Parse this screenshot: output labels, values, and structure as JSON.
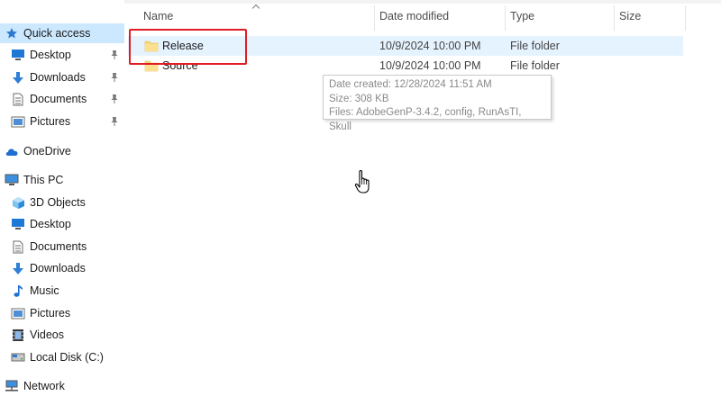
{
  "sidebar": {
    "quick_access": "Quick access",
    "qa_items": [
      {
        "label": "Desktop",
        "icon": "desktop-icon"
      },
      {
        "label": "Downloads",
        "icon": "download-arrow-icon"
      },
      {
        "label": "Documents",
        "icon": "documents-icon"
      },
      {
        "label": "Pictures",
        "icon": "pictures-icon"
      }
    ],
    "onedrive": "OneDrive",
    "this_pc": "This PC",
    "pc_items": [
      {
        "label": "3D Objects",
        "icon": "3d-objects-icon"
      },
      {
        "label": "Desktop",
        "icon": "desktop-icon"
      },
      {
        "label": "Documents",
        "icon": "documents-icon"
      },
      {
        "label": "Downloads",
        "icon": "download-arrow-icon"
      },
      {
        "label": "Music",
        "icon": "music-icon"
      },
      {
        "label": "Pictures",
        "icon": "pictures-icon"
      },
      {
        "label": "Videos",
        "icon": "videos-icon"
      },
      {
        "label": "Local Disk (C:)",
        "icon": "local-disk-icon"
      }
    ],
    "network": "Network"
  },
  "columns": {
    "name": "Name",
    "date_modified": "Date modified",
    "type": "Type",
    "size": "Size"
  },
  "files": [
    {
      "name": "Release",
      "date": "10/9/2024 10:00 PM",
      "type": "File folder",
      "size": ""
    },
    {
      "name": "Source",
      "date": "10/9/2024 10:00 PM",
      "type": "File folder",
      "size": ""
    }
  ],
  "tooltip": {
    "created": "Date created: 12/28/2024 11:51 AM",
    "size": "Size: 308 KB",
    "files": "Files: AdobeGenP-3.4.2, config, RunAsTI, Skull"
  },
  "colors": {
    "selection": "#cce8ff",
    "hover": "#e5f3ff",
    "highlight_box": "#e01d24",
    "folder": "#f8d775"
  }
}
